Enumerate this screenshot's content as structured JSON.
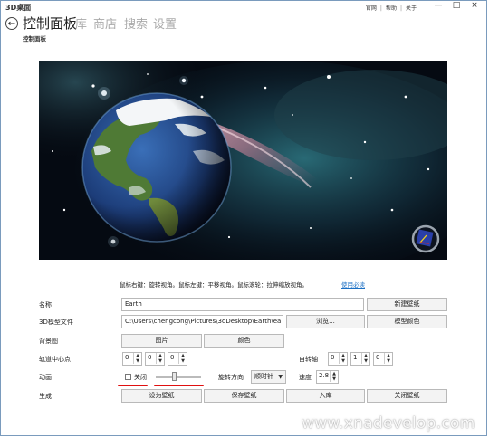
{
  "window": {
    "app_title": "3D桌面",
    "top_links": [
      "官网",
      "帮助",
      "关于"
    ],
    "controls": {
      "minimize": "—",
      "maximize": "□",
      "close": "×"
    }
  },
  "nav": {
    "back_icon": "back-arrow-icon",
    "current": "控制面板",
    "tabs": [
      "库",
      "商店",
      "搜索",
      "设置"
    ]
  },
  "page": {
    "subtitle": "控制面板"
  },
  "viewport": {
    "hint": "鼠标右键：旋转视角。鼠标左键：平移视角。鼠标滚轮：拉伸缩放视角。",
    "help_link": "使用必读"
  },
  "form": {
    "name": {
      "label": "名称",
      "value": "Earth",
      "button": "新建壁纸"
    },
    "model_file": {
      "label": "3D模型文件",
      "value": "C:\\Users\\chengcong\\Pictures\\3dDesktop\\Earth\\ea",
      "browse": "浏览...",
      "color_button": "模型颜色"
    },
    "background": {
      "label": "背景图",
      "image_button": "图片",
      "color_button": "颜色"
    },
    "orbit_center": {
      "label": "轨道中心点",
      "values": [
        "0",
        "0",
        "0"
      ]
    },
    "rotation_axis": {
      "label": "自转轴",
      "values": [
        "0",
        "1",
        "0"
      ]
    },
    "animation": {
      "label": "动画",
      "checkbox_label": "关闭",
      "slider_level": 0.4,
      "direction_label": "旋转方向",
      "direction_value": "顺时针",
      "speed_label": "速度",
      "speed_value": "2.8"
    },
    "generate": {
      "label": "生成",
      "buttons": [
        "设为壁纸",
        "保存壁纸",
        "入库",
        "关闭壁纸"
      ]
    }
  },
  "watermark": "www.xnadevelop.com",
  "colors": {
    "link": "#1a6fc4",
    "annotation": "#e01010",
    "space_bg": "#050a12",
    "frame": "#7a9bbd"
  }
}
